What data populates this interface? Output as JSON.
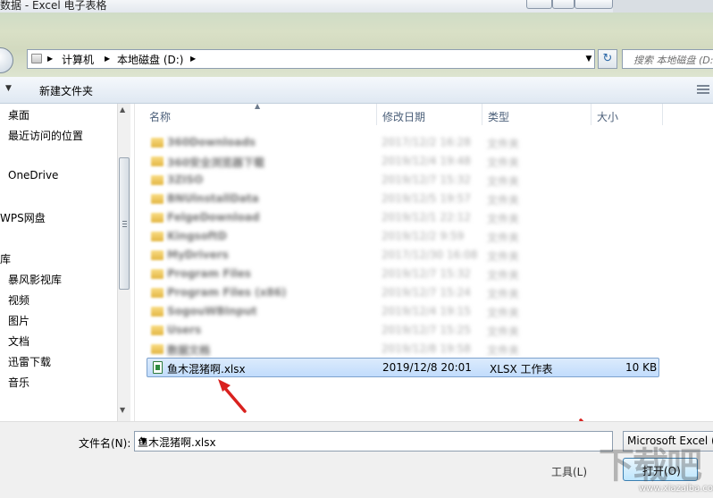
{
  "window": {
    "title": "数据 - Excel 电子表格"
  },
  "address_bar": {
    "breadcrumb": [
      "计算机",
      "本地磁盘 (D:)"
    ],
    "search_placeholder": "搜索 本地磁盘 (D:)"
  },
  "toolbar": {
    "new_folder_label": "新建文件夹"
  },
  "nav_pane": {
    "items": [
      "桌面",
      "最近访问的位置",
      "OneDrive",
      "WPS网盘",
      "库",
      "暴风影视库",
      "视频",
      "图片",
      "文档",
      "迅雷下载",
      "音乐"
    ]
  },
  "file_list": {
    "columns": {
      "name": "名称",
      "date": "修改日期",
      "type": "类型",
      "size": "大小"
    },
    "blurred_folders": [
      {
        "name": "360Downloads",
        "date": "2017/12/2 16:28",
        "type": "文件夹"
      },
      {
        "name": "360安全浏览器下载",
        "date": "2019/12/4 19:48",
        "type": "文件夹"
      },
      {
        "name": "3ZISO",
        "date": "2019/12/7 15:32",
        "type": "文件夹"
      },
      {
        "name": "BNUlnstallData",
        "date": "2019/12/5 19:57",
        "type": "文件夹"
      },
      {
        "name": "FelgeDownload",
        "date": "2019/12/1 22:12",
        "type": "文件夹"
      },
      {
        "name": "KingsoftD",
        "date": "2019/12/2 9:59",
        "type": "文件夹"
      },
      {
        "name": "MyDrivers",
        "date": "2017/12/30 16:08",
        "type": "文件夹"
      },
      {
        "name": "Program Files",
        "date": "2019/12/7 15:32",
        "type": "文件夹"
      },
      {
        "name": "Program Files (x86)",
        "date": "2019/12/7 15:24",
        "type": "文件夹"
      },
      {
        "name": "SogouWBInput",
        "date": "2019/12/4 19:15",
        "type": "文件夹"
      },
      {
        "name": "Users",
        "date": "2019/12/7 15:25",
        "type": "文件夹"
      },
      {
        "name": "数据文档",
        "date": "2019/12/8 19:58",
        "type": "文件夹"
      }
    ],
    "selected_file": {
      "name": "鱼木混猪啊.xlsx",
      "date": "2019/12/8 20:01",
      "type": "XLSX 工作表",
      "size": "10 KB"
    }
  },
  "bottom": {
    "filename_label": "文件名(N):",
    "filename_value": "鱼木混猪啊.xlsx",
    "filter_value": "Microsoft Excel (",
    "tools_label": "工具(L)",
    "open_label": "打开(O)"
  },
  "watermark": {
    "text": "下载吧",
    "site": "www.xiazaiba.com"
  },
  "colors": {
    "selection": "#cce4fc",
    "arrow": "#d9211e",
    "column_header_text": "#4c607a"
  }
}
